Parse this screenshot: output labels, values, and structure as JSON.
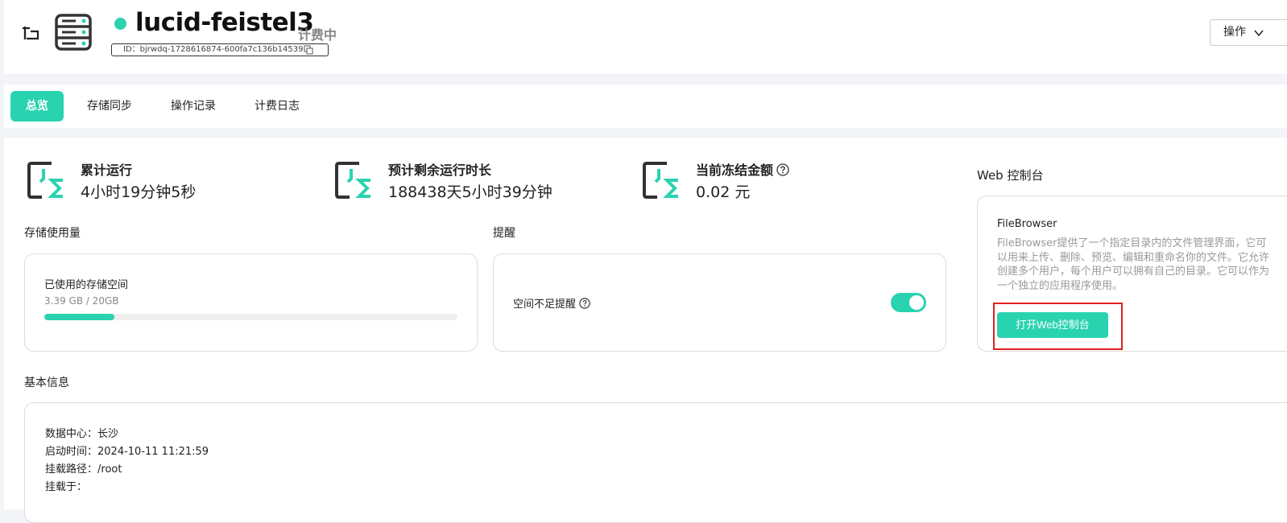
{
  "header": {
    "instance_name": "lucid-feistel3",
    "billing_status": "计费中",
    "instance_id": "ID：bjrwdq-1728616874-600fa7c136b14539",
    "ops_label": "操作"
  },
  "tabs": [
    {
      "label": "总览",
      "active": true
    },
    {
      "label": "存储同步",
      "active": false
    },
    {
      "label": "操作记录",
      "active": false
    },
    {
      "label": "计费日志",
      "active": false
    }
  ],
  "stats": [
    {
      "label": "累计运行",
      "value": "4小时19分钟5秒"
    },
    {
      "label": "预计剩余运行时长",
      "value": "188438天5小时39分钟"
    },
    {
      "label": "当前冻结金额",
      "value": "0.02 元"
    }
  ],
  "storage": {
    "section_title": "存储使用量",
    "label": "已使用的存储空间",
    "value": "3.39 GB / 20GB",
    "used_fraction": 0.17
  },
  "reminder": {
    "section_title": "提醒",
    "label": "空间不足提醒",
    "enabled": true
  },
  "web_console": {
    "section_title": "Web 控制台",
    "app_name": "FileBrowser",
    "description": "FileBrowser提供了一个指定目录内的文件管理界面，它可以用来上传、删除、预览、编辑和重命名你的文件。它允许创建多个用户，每个用户可以拥有自己的目录。它可以作为一个独立的应用程序使用。",
    "open_button": "打开Web控制台"
  },
  "basic_info": {
    "section_title": "基本信息",
    "lines": [
      "数据中心：长沙",
      "启动时间：2024-10-11 11:21:59",
      "挂载路径：/root",
      "挂载于："
    ]
  },
  "colors": {
    "accent": "#2ad3b0",
    "highlight": "#e02020"
  }
}
